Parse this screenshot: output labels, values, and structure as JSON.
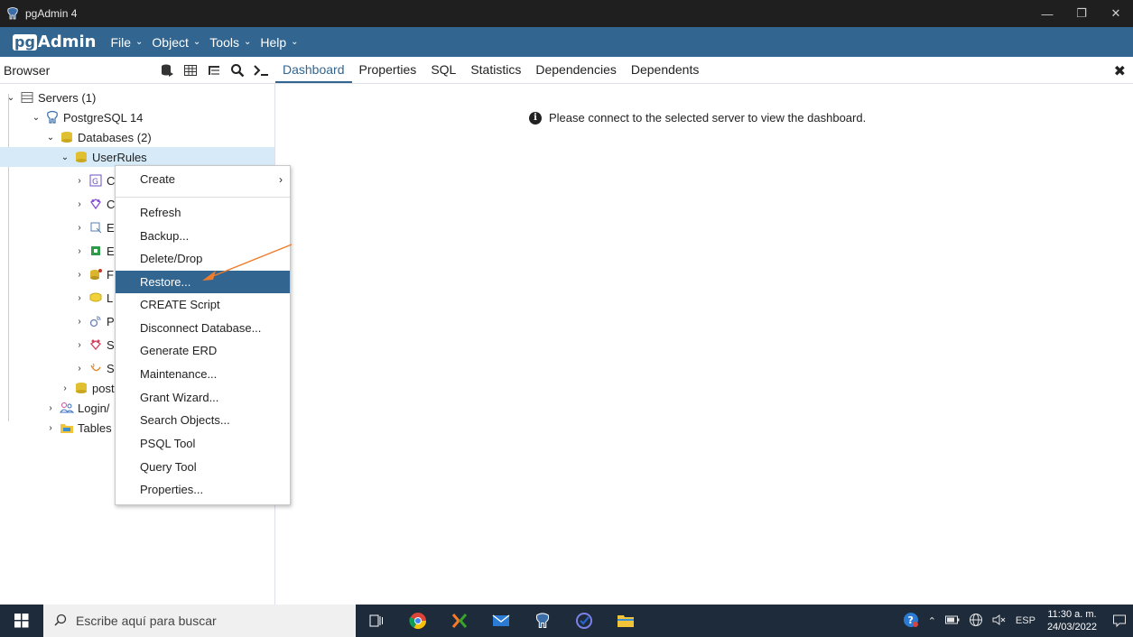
{
  "window": {
    "title": "pgAdmin 4"
  },
  "menubar": {
    "logo_pg": "pg",
    "logo_admin": "Admin",
    "menus": [
      {
        "label": "File"
      },
      {
        "label": "Object"
      },
      {
        "label": "Tools"
      },
      {
        "label": "Help"
      }
    ]
  },
  "browser": {
    "title": "Browser"
  },
  "tabs": [
    "Dashboard",
    "Properties",
    "SQL",
    "Statistics",
    "Dependencies",
    "Dependents"
  ],
  "tree": [
    {
      "label": "Servers (1)"
    },
    {
      "label": "PostgreSQL 14"
    },
    {
      "label": "Databases (2)"
    },
    {
      "label": "UserRules"
    },
    {
      "label": "C"
    },
    {
      "label": "C"
    },
    {
      "label": "E"
    },
    {
      "label": "E"
    },
    {
      "label": "F"
    },
    {
      "label": "L"
    },
    {
      "label": "P"
    },
    {
      "label": "S"
    },
    {
      "label": "S"
    },
    {
      "label": "post"
    },
    {
      "label": "Login/"
    },
    {
      "label": "Tables"
    }
  ],
  "dashboard": {
    "message": "Please connect to the selected server to view the dashboard."
  },
  "context_menu": {
    "items": [
      {
        "label": "Create"
      },
      {
        "label": "Refresh"
      },
      {
        "label": "Backup..."
      },
      {
        "label": "Delete/Drop"
      },
      {
        "label": "Restore..."
      },
      {
        "label": "CREATE Script"
      },
      {
        "label": "Disconnect Database..."
      },
      {
        "label": "Generate ERD"
      },
      {
        "label": "Maintenance..."
      },
      {
        "label": "Grant Wizard..."
      },
      {
        "label": "Search Objects..."
      },
      {
        "label": "PSQL Tool"
      },
      {
        "label": "Query Tool"
      },
      {
        "label": "Properties..."
      }
    ]
  },
  "taskbar": {
    "search_placeholder": "Escribe aquí para buscar",
    "language": "ESP",
    "time": "11:30 a. m.",
    "date": "24/03/2022"
  },
  "colors": {
    "menubar": "#326690",
    "selected_row": "#d6eaf8",
    "highlight": "#326690",
    "annotation_arrow": "#f07b2b"
  }
}
